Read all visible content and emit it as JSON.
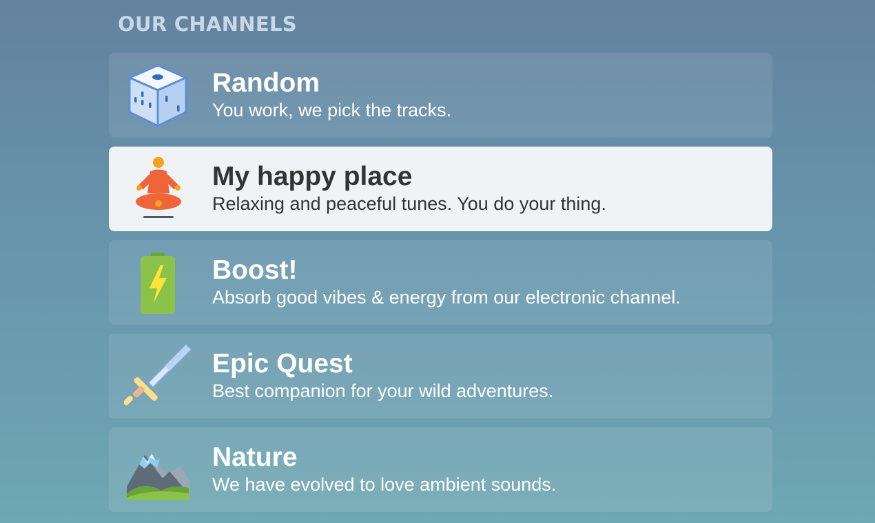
{
  "section": {
    "title": "OUR CHANNELS"
  },
  "channels": [
    {
      "name": "Random",
      "description": "You work, we pick the tracks.",
      "icon": "dice-icon"
    },
    {
      "name": "My happy place",
      "description": "Relaxing and peaceful tunes. You do your thing.",
      "icon": "meditation-icon",
      "selected": true
    },
    {
      "name": "Boost!",
      "description": "Absorb good vibes & energy from our electronic channel.",
      "icon": "battery-icon"
    },
    {
      "name": "Epic Quest",
      "description": "Best companion for your wild adventures.",
      "icon": "sword-icon"
    },
    {
      "name": "Nature",
      "description": "We have evolved to love ambient sounds.",
      "icon": "mountain-icon"
    }
  ],
  "colors": {
    "background_top": "#63829f",
    "background_bottom": "#6fa7b2",
    "selected_card": "#eff3f6",
    "title_text": "#c9d8e6"
  }
}
